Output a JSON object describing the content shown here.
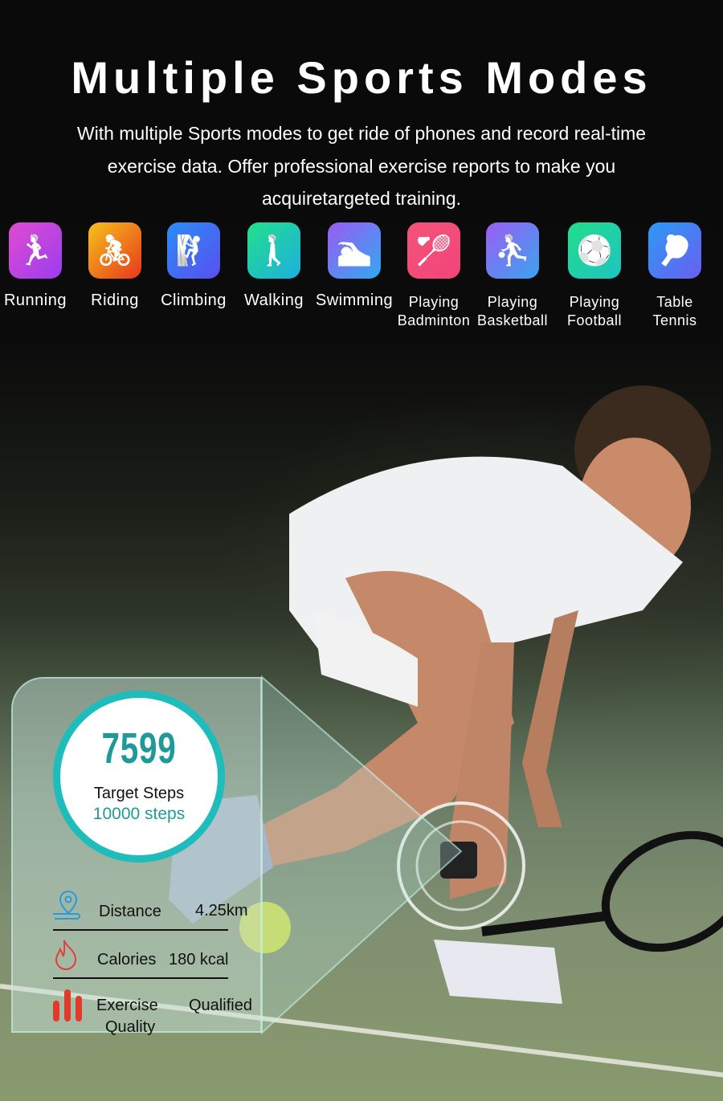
{
  "header": {
    "title": "Multiple Sports Modes",
    "description": "With multiple Sports modes to get ride of phones and record real-time exercise data. Offer professional exercise reports to make you acquiretargeted training."
  },
  "modes": [
    {
      "label": "Running",
      "icon": "running-icon",
      "colors": [
        "#e14bd0",
        "#9b3df0"
      ]
    },
    {
      "label": "Riding",
      "icon": "cycling-icon",
      "colors": [
        "#f5c21c",
        "#e8371c"
      ]
    },
    {
      "label": "Climbing",
      "icon": "climbing-icon",
      "colors": [
        "#2a8df5",
        "#5a4ef0"
      ]
    },
    {
      "label": "Walking",
      "icon": "walking-icon",
      "colors": [
        "#22e08a",
        "#1eaee0"
      ]
    },
    {
      "label": "Swimming",
      "icon": "swimming-icon",
      "colors": [
        "#9b5cf2",
        "#30a8f0"
      ]
    },
    {
      "label": "Playing Badminton",
      "line1": "Playing",
      "line2": "Badminton",
      "icon": "badminton-icon",
      "colors": [
        "#f5537a",
        "#f0457a"
      ]
    },
    {
      "label": "Playing Basketball",
      "line1": "Playing",
      "line2": "Basketball",
      "icon": "basketball-icon",
      "colors": [
        "#9a5ef2",
        "#3aa3f0"
      ]
    },
    {
      "label": "Playing Football",
      "line1": "Playing",
      "line2": "Football",
      "icon": "football-icon",
      "colors": [
        "#22dd8c",
        "#1ec4c0"
      ]
    },
    {
      "label": "Table Tennis",
      "line1": "Table",
      "line2": "Tennis",
      "icon": "table-tennis-icon",
      "colors": [
        "#2b9bf5",
        "#6a5ef0"
      ]
    }
  ],
  "stats": {
    "steps": "7599",
    "target_label": "Target Steps",
    "target_value": "10000 steps",
    "distance_label": "Distance",
    "distance_value": "4.25km",
    "calories_label": "Calories",
    "calories_value": "180 kcal",
    "quality_label_1": "Exercise",
    "quality_label_2": "Quality",
    "quality_value": "Qualified",
    "accent": "#1fbcbc"
  }
}
